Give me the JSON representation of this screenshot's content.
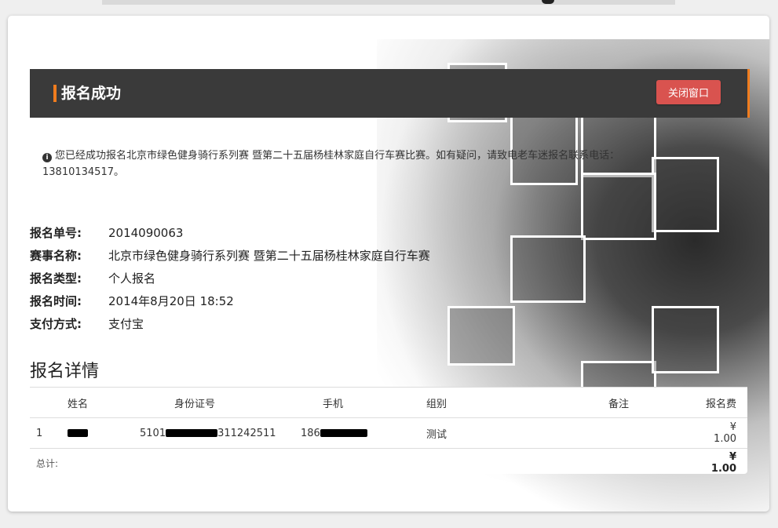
{
  "header": {
    "title": "报名成功",
    "close_label": "关闭窗口"
  },
  "notice": "您已经成功报名北京市绿色健身骑行系列赛 暨第二十五届杨桂林家庭自行车赛比赛。如有疑问，请致电老车迷报名联系电话：13810134517。",
  "details": [
    {
      "label": "报名单号:",
      "value": "2014090063"
    },
    {
      "label": "赛事名称:",
      "value": "北京市绿色健身骑行系列赛 暨第二十五届杨桂林家庭自行车赛"
    },
    {
      "label": "报名类型:",
      "value": "个人报名"
    },
    {
      "label": "报名时间:",
      "value": "2014年8月20日 18:52"
    },
    {
      "label": "支付方式:",
      "value": "支付宝"
    }
  ],
  "section_title": "报名详情",
  "table": {
    "headers": {
      "index": "",
      "name": "姓名",
      "id": "身份证号",
      "phone": "手机",
      "group": "组别",
      "note": "备注",
      "fee": "报名费"
    },
    "rows": [
      {
        "index": "1",
        "name_visible": "",
        "id_prefix": "5101",
        "id_suffix": "311242511",
        "phone_prefix": "186",
        "phone_suffix": "",
        "group": "测试",
        "note": "",
        "fee": "¥ 1.00"
      }
    ],
    "total_label": "总计:",
    "total_value": "¥ 1.00"
  }
}
